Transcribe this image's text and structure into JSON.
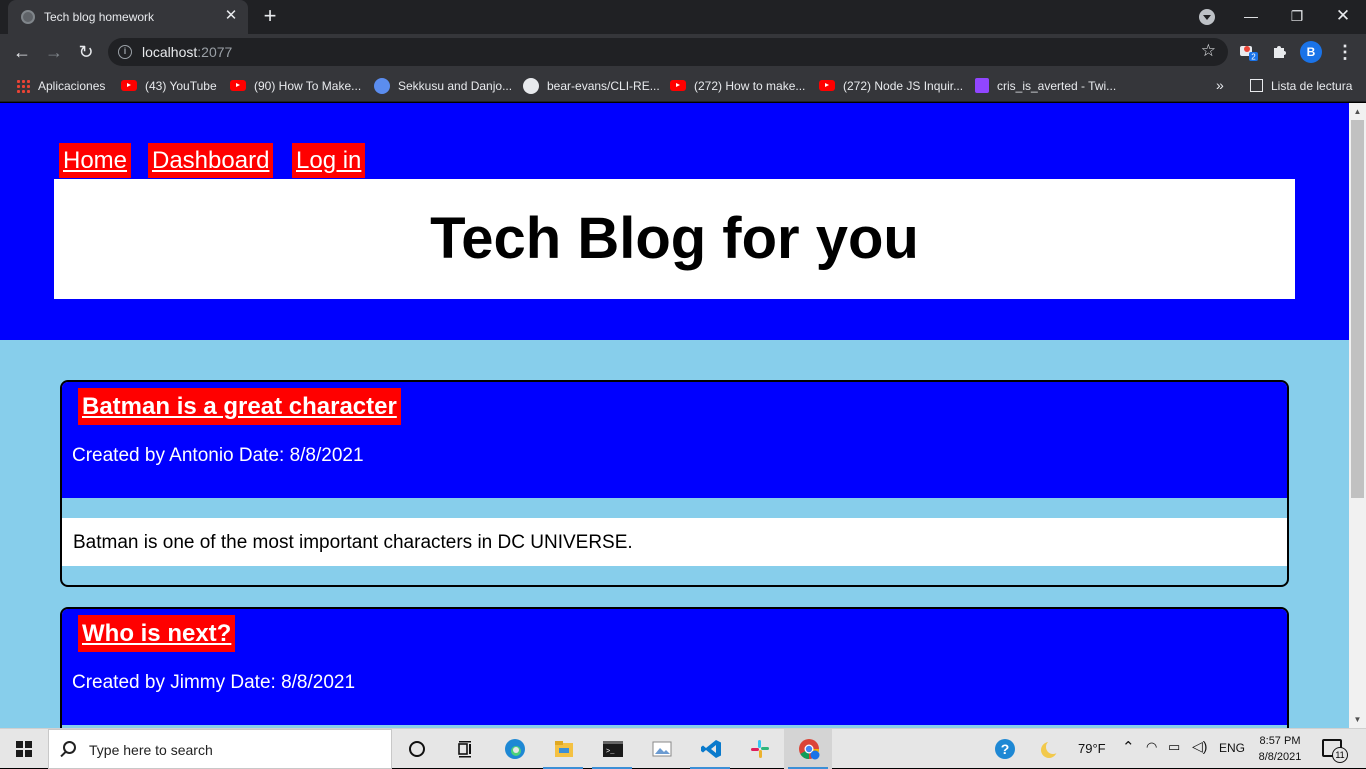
{
  "browser": {
    "tab_title": "Tech blog homework",
    "url_host": "localhost",
    "url_port": ":2077",
    "avatar_letter": "B",
    "extension_badge": "2"
  },
  "bookmarks": [
    {
      "label": "Aplicaciones",
      "icon": "apps-icon"
    },
    {
      "label": "(43) YouTube",
      "icon": "youtube-icon"
    },
    {
      "label": "(90) How To Make...",
      "icon": "youtube-icon"
    },
    {
      "label": "Sekkusu and Danjo...",
      "icon": "site-icon"
    },
    {
      "label": "bear-evans/CLI-RE...",
      "icon": "github-icon"
    },
    {
      "label": "(272) How to make...",
      "icon": "youtube-icon"
    },
    {
      "label": "(272) Node JS Inquir...",
      "icon": "youtube-icon"
    },
    {
      "label": "cris_is_averted - Twi...",
      "icon": "twitch-icon"
    }
  ],
  "bookmarks_more": "»",
  "reading_list": "Lista de lectura",
  "site": {
    "nav": [
      "Home",
      "Dashboard",
      "Log in"
    ],
    "title": "Tech Blog for you"
  },
  "posts": [
    {
      "title": "Batman is a great character",
      "meta": "Created by Antonio Date: 8/8/2021",
      "body": "Batman is one of the most important characters in DC UNIVERSE."
    },
    {
      "title": "Who is next?",
      "meta": "Created by Jimmy Date: 8/8/2021",
      "body": ""
    }
  ],
  "taskbar": {
    "search_placeholder": "Type here to search",
    "weather": "79°F",
    "language": "ENG",
    "time": "8:57 PM",
    "date": "8/8/2021",
    "notifications": "11",
    "accent": "#3c8fd6"
  },
  "colors": {
    "header_bg": "#0000ff",
    "page_bg": "#87ceeb",
    "link_bg": "#ff0000"
  }
}
